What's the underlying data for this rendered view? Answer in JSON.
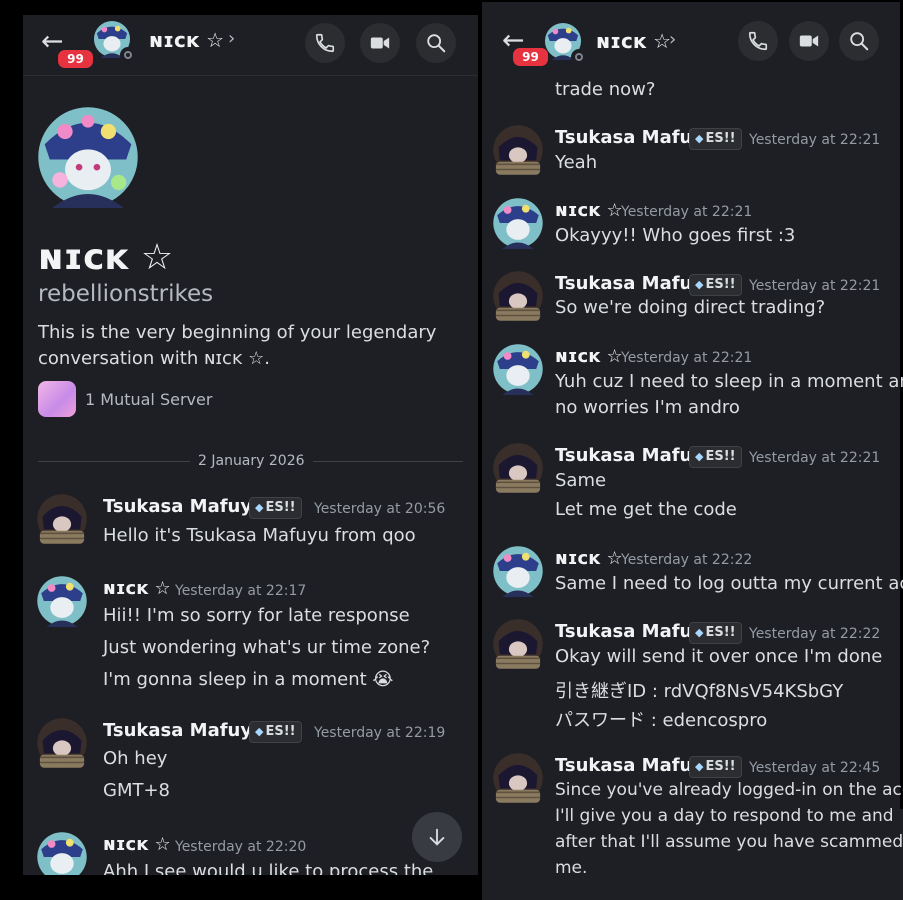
{
  "left": {
    "header": {
      "back_icon": "arrow-left-icon",
      "badge": "99",
      "name": "ɴɪᴄᴋ ☆",
      "chevron": "›"
    },
    "profile": {
      "display_name": "ɴɪᴄᴋ ☆",
      "username": "rebellionstrikes",
      "intro": "This is the very beginning of your legendary conversation with ɴɪᴄᴋ ☆.",
      "mutual": "1 Mutual Server"
    },
    "date_divider": "2 January 2026",
    "messages": [
      {
        "author": "Tsukasa Mafuyu",
        "tag": "ES!!",
        "time": "Yesterday at 20:56",
        "lines": [
          "Hello it's Tsukasa Mafuyu from qoo"
        ]
      },
      {
        "author": "ɴɪᴄᴋ ☆",
        "time": "Yesterday at 22:17",
        "lines": [
          "Hii!! I'm so sorry for late response",
          "Just wondering what's ur time zone?",
          "I'm gonna sleep in a moment 😭"
        ]
      },
      {
        "author": "Tsukasa Mafuyu",
        "tag": "ES!!",
        "time": "Yesterday at 22:19",
        "lines": [
          "Oh hey",
          "GMT+8"
        ]
      },
      {
        "author": "ɴɪᴄᴋ ☆",
        "time": "Yesterday at 22:20",
        "lines": [
          "Ahh I see would u like to process the"
        ]
      }
    ]
  },
  "right": {
    "header": {
      "badge": "99",
      "name": "ɴɪᴄᴋ ☆",
      "chevron": "›"
    },
    "top_fragment": "trade now?",
    "messages": [
      {
        "author": "Tsukasa Mafuyu",
        "tag": "ES!!",
        "time": "Yesterday at 22:21",
        "lines": [
          "Yeah"
        ]
      },
      {
        "author": "ɴɪᴄᴋ ☆",
        "time": "Yesterday at 22:21",
        "lines": [
          "Okayyy!! Who goes first :3"
        ]
      },
      {
        "author": "Tsukasa Mafuyu",
        "tag": "ES!!",
        "time": "Yesterday at 22:21",
        "lines": [
          "So we're doing direct trading?"
        ]
      },
      {
        "author": "ɴɪᴄᴋ ☆",
        "time": "Yesterday at 22:21",
        "lines": [
          "Yuh cuz I need to sleep in a moment and",
          "no worries I'm andro"
        ]
      },
      {
        "author": "Tsukasa Mafuyu",
        "tag": "ES!!",
        "time": "Yesterday at 22:21",
        "lines": [
          "Same",
          "Let me get the code"
        ]
      },
      {
        "author": "ɴɪᴄᴋ ☆",
        "time": "Yesterday at 22:22",
        "lines": [
          "Same I need to log outta my current acc"
        ]
      },
      {
        "author": "Tsukasa Mafuyu",
        "tag": "ES!!",
        "time": "Yesterday at 22:22",
        "lines": [
          "Okay will send it over once I'm done",
          "引き継ぎID : rdVQf8NsV54KSbGY",
          "パスワード : edencospro"
        ]
      },
      {
        "author": "Tsukasa Mafuyu",
        "tag": "ES!!",
        "time": "Yesterday at 22:45",
        "lines": [
          "Since you've already logged-in on the acc",
          "I'll give you a day to respond to me and",
          "after that I'll assume you have scammed",
          "me."
        ]
      }
    ]
  },
  "colors": {
    "bg": "#1e1f24",
    "badge": "#e7333f",
    "text": "#dbdee1",
    "muted": "#949ba4"
  }
}
